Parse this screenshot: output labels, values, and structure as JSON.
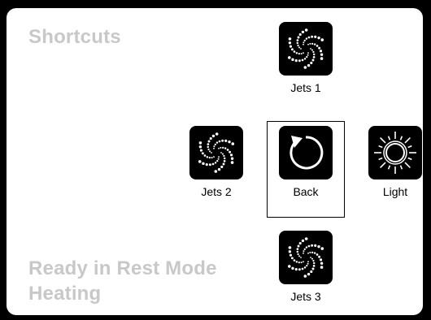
{
  "screen": {
    "title": "Shortcuts",
    "status_lines": [
      "Ready in Rest Mode",
      "Heating"
    ]
  },
  "shortcuts": [
    {
      "label": "Jets 1",
      "icon": "jets-icon",
      "selected": false
    },
    {
      "label": "Jets 2",
      "icon": "jets-icon",
      "selected": false
    },
    {
      "label": "Back",
      "icon": "back-arrow-icon",
      "selected": true
    },
    {
      "label": "Light",
      "icon": "light-icon",
      "selected": false
    },
    {
      "label": "Jets 3",
      "icon": "jets-icon",
      "selected": false
    }
  ],
  "colors": {
    "background": "#000000",
    "panel": "#ffffff",
    "title_text": "#c8c8c8",
    "icon_tile": "#000000"
  }
}
